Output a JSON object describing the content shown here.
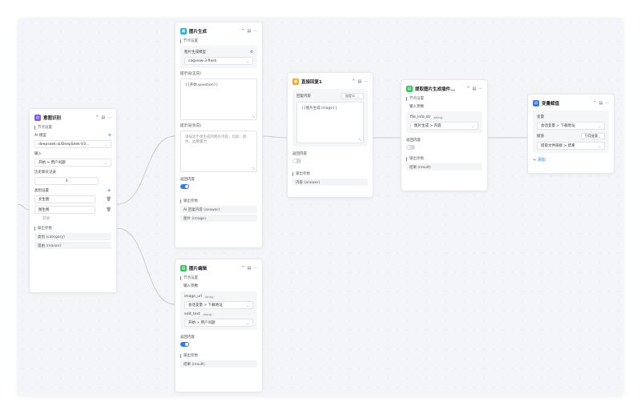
{
  "colors": {
    "accent": "#2d7cf6",
    "purple": "#7c5cf0",
    "cyan": "#1bb8e0",
    "orange": "#f5a623",
    "green": "#34c759",
    "blue": "#3b7cf6"
  },
  "common": {
    "node_settings": "节点设置",
    "output_params": "输出参数",
    "input_params": "输入参数",
    "collapse": "^",
    "settings": "▤",
    "more": "···"
  },
  "intent": {
    "title": "意图识别",
    "icon": "intent-icon",
    "ai_model_label": "AI 模型",
    "ai_model_value": "deepseek-ai/DeepSeek-V3...",
    "input_label": "输入",
    "input_value": "开始 > 用户问题",
    "history_label": "历史聊天记录",
    "history_value": "3",
    "categories_label": "类别设置",
    "categories": [
      "文生图",
      "图生图",
      "其他"
    ],
    "outputs": [
      "类别 (category)",
      "理由 (reason)"
    ]
  },
  "imggen": {
    "title": "图片生成",
    "model_label": "图片生成模型",
    "model_value": "cogview-3-flash",
    "prompt_label": "提示词(正向)",
    "prompt_value": "{{开始.question}}",
    "neg_label": "提示词(负向)",
    "neg_placeholder": "请描述不想生成的图片内容，比如：颜色、血腥暴力",
    "output_content_label": "返回内容",
    "outputs": [
      "AI 回复内容 (answer)",
      "图片 (image)"
    ]
  },
  "imgedit": {
    "title": "图片编辑",
    "image_url_label": "image_url",
    "image_url_type": "string",
    "image_url_value": "会话变量 > 下载地址",
    "edit_text_label": "edit_text",
    "edit_text_type": "string",
    "edit_text_value": "开始 > 用户问题",
    "output_content_label": "返回内容",
    "outputs": [
      "结果 (result)"
    ]
  },
  "reply": {
    "title": "直接回复1",
    "reply_label": "回复内容",
    "reply_mode": "自定义",
    "reply_value": "{{图片生成.image}}",
    "output_content_label": "返回内容",
    "outputs": [
      "内容 (answer)"
    ]
  },
  "extract": {
    "title": "提取图片生成插件...",
    "file_info_label": "file_info_str",
    "file_info_type": "string",
    "file_info_value": "图片生成 > 内容",
    "output_content_label": "返回内容",
    "outputs": [
      "结果 (result)"
    ]
  },
  "varassign": {
    "title": "变量赋值",
    "variable_label": "变量",
    "variable_value": "会话变量 > 下载地址",
    "value_label": "赋值",
    "value_mode": "引用变量",
    "value_value": "提取文件链接 > 结果",
    "add_label": "+ 添加"
  }
}
